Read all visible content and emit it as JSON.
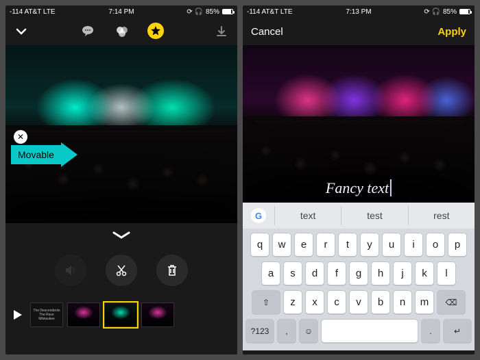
{
  "left": {
    "status": {
      "signal": "-114 AT&T  LTE",
      "time": "7:14 PM",
      "battery_pct": "85%"
    },
    "sticker": {
      "label": "Movable"
    },
    "actions": {
      "mute": "sound-off",
      "cut": "scissors",
      "trash": "trash"
    },
    "thumbs": {
      "text_card": "The\nDescendents\nThe Rave\nMilwaukee"
    }
  },
  "right": {
    "status": {
      "signal": "-114 AT&T  LTE",
      "time": "7:13 PM",
      "battery_pct": "85%"
    },
    "header": {
      "cancel": "Cancel",
      "apply": "Apply"
    },
    "overlay_text": "Fancy text",
    "suggestions": {
      "s1": "text",
      "s2": "test",
      "s3": "rest"
    },
    "keyboard": {
      "row1": [
        "q",
        "w",
        "e",
        "r",
        "t",
        "y",
        "u",
        "i",
        "o",
        "p"
      ],
      "row2": [
        "a",
        "s",
        "d",
        "f",
        "g",
        "h",
        "j",
        "k",
        "l"
      ],
      "row3": [
        "z",
        "x",
        "c",
        "v",
        "b",
        "n",
        "m"
      ],
      "fn_shift": "⇧",
      "fn_backspace": "⌫",
      "fn_numbers": "?123",
      "fn_emoji": "☺",
      "fn_return": "↵",
      "fn_comma": ",",
      "fn_period": "."
    }
  }
}
